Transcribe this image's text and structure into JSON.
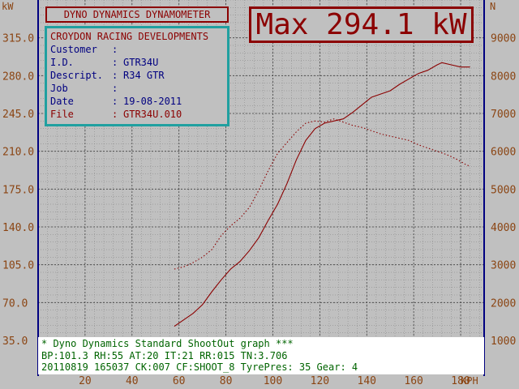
{
  "header": {
    "title": "DYNO DYNAMICS DYNAMOMETER",
    "max_power": "Max 294.1 kW"
  },
  "info": {
    "company": "CROYDON RACING DEVELOPMENTS",
    "rows": [
      {
        "key": "Customer",
        "value": ""
      },
      {
        "key": "I.D.",
        "value": "GTR34U"
      },
      {
        "key": "Descript.",
        "value": "R34 GTR"
      },
      {
        "key": "Job",
        "value": ""
      },
      {
        "key": "Date",
        "value": "19-08-2011"
      },
      {
        "key": "File",
        "value": "GTR34U.010"
      }
    ]
  },
  "footer": {
    "line1": "* Dyno Dynamics Standard ShootOut graph ***",
    "line2": "BP:101.3 RH:55 AT:20 IT:21  RR:015 TN:3.706",
    "line3": "20110819 165037 CK:007 CF:SHOOT_8  TyrePres: 35      Gear: 4"
  },
  "chart_data": {
    "type": "line",
    "x_axis": {
      "unit": "KPH",
      "ticks": [
        20,
        40,
        60,
        80,
        100,
        120,
        140,
        160,
        180
      ],
      "range": [
        0,
        190
      ]
    },
    "y_axis_left": {
      "unit": "kW",
      "ticks": [
        "35.0",
        "70.0",
        "105.0",
        "140.0",
        "175.0",
        "210.0",
        "245.0",
        "280.0",
        "315.0"
      ],
      "range": [
        35,
        350
      ]
    },
    "y_axis_right": {
      "unit": "N",
      "ticks": [
        "1000",
        "2000",
        "3000",
        "4000",
        "5000",
        "6000",
        "7000",
        "8000",
        "9000"
      ],
      "range": [
        1000,
        10000
      ]
    },
    "grid": true,
    "series": [
      {
        "axis": "left",
        "color": "#8b0000",
        "dashed": false,
        "x": [
          58,
          62,
          66,
          70,
          74,
          78,
          82,
          86,
          90,
          94,
          98,
          102,
          106,
          110,
          114,
          118,
          122,
          126,
          130,
          134,
          138,
          142,
          146,
          150,
          154,
          158,
          162,
          166,
          170,
          172,
          176,
          180,
          184
        ],
        "y": [
          48,
          54,
          60,
          68,
          80,
          91,
          101,
          108,
          118,
          130,
          146,
          161,
          180,
          202,
          220,
          231,
          236,
          238,
          240,
          246,
          253,
          260,
          263,
          266,
          272,
          277,
          282,
          285,
          290,
          292,
          290,
          288,
          288
        ]
      },
      {
        "axis": "left",
        "color": "#8b0000",
        "dashed": true,
        "x": [
          58,
          62,
          66,
          70,
          74,
          78,
          82,
          86,
          90,
          94,
          98,
          102,
          106,
          110,
          114,
          118,
          122,
          126,
          130,
          134,
          138,
          142,
          146,
          150,
          154,
          158,
          162,
          166,
          170,
          174,
          178,
          182,
          184
        ],
        "y": [
          101,
          103,
          107,
          112,
          119,
          132,
          141,
          148,
          158,
          174,
          192,
          208,
          218,
          228,
          236,
          238,
          237,
          240,
          237,
          234,
          232,
          229,
          226,
          224,
          222,
          220,
          216,
          213,
          210,
          207,
          203,
          198,
          196
        ]
      }
    ]
  }
}
